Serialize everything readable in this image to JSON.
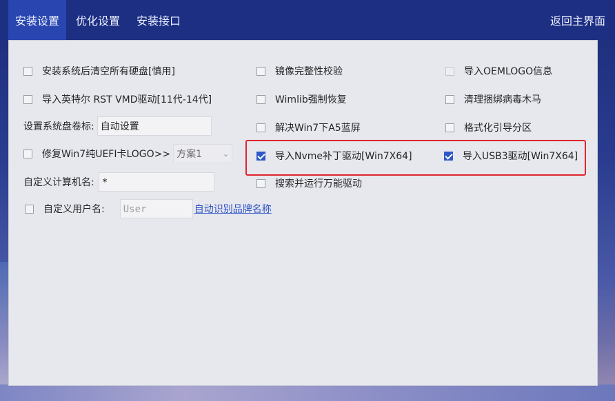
{
  "tabs": [
    {
      "label": "安装设置",
      "active": true
    },
    {
      "label": "优化设置",
      "active": false
    },
    {
      "label": "安装接口",
      "active": false
    }
  ],
  "back_label": "返回主界面",
  "options": {
    "clear_disks": {
      "label": "安装系统后清空所有硬盘[慎用]",
      "checked": false
    },
    "import_rst": {
      "label": "导入英特尔 RST VMD驱动[11代-14代]",
      "checked": false
    },
    "fix_uefi_logo": {
      "label": "修复Win7纯UEFI卡LOGO>>",
      "checked": false
    },
    "image_verify": {
      "label": "镜像完整性校验",
      "checked": false
    },
    "wimlib_restore": {
      "label": "Wimlib强制恢复",
      "checked": false
    },
    "fix_a5": {
      "label": "解决Win7下A5蓝屏",
      "checked": false
    },
    "nvme_patch": {
      "label": "导入Nvme补丁驱动[Win7X64]",
      "checked": true
    },
    "search_drivers": {
      "label": "搜索并运行万能驱动",
      "checked": false
    },
    "oem_logo": {
      "label": "导入OEMLOGO信息",
      "checked": false
    },
    "clean_trojan": {
      "label": "清理捆绑病毒木马",
      "checked": false
    },
    "format_boot": {
      "label": "格式化引导分区",
      "checked": false
    },
    "usb3_driver": {
      "label": "导入USB3驱动[Win7X64]",
      "checked": true
    },
    "custom_user": {
      "label": "自定义用户名:",
      "checked": false
    }
  },
  "volume_label": {
    "label": "设置系统盘卷标:",
    "value": "自动设置"
  },
  "scheme_select": {
    "value": "方案1"
  },
  "computer_name": {
    "label": "自定义计算机名:",
    "value": "*"
  },
  "user_name": {
    "placeholder": "User"
  },
  "brand_link": "自动识别品牌名称",
  "accent_colors": {
    "header": "#1c2f83",
    "active_tab": "#2845b0",
    "checkbox_checked": "#2d58c7",
    "highlight": "#e0252b"
  }
}
